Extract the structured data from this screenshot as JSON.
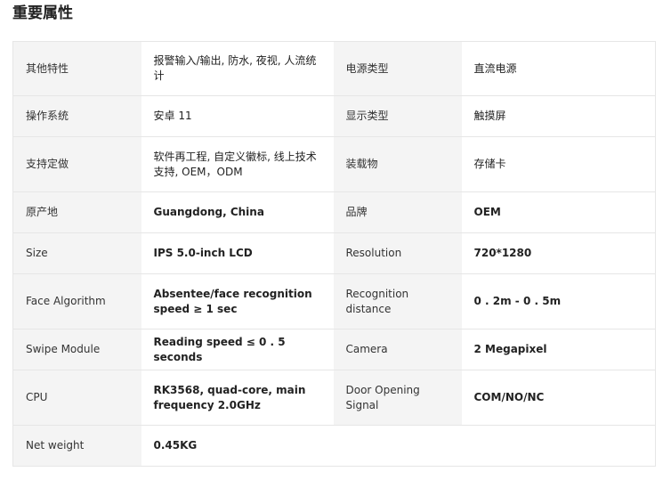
{
  "section_title": "重要属性",
  "rows": [
    [
      {
        "key": "其他特性",
        "value": "报警输入/输出, 防水, 夜视, 人流统计"
      },
      {
        "key": "电源类型",
        "value": "直流电源"
      }
    ],
    [
      {
        "key": "操作系统",
        "value": "安卓 11"
      },
      {
        "key": "显示类型",
        "value": "触摸屏"
      }
    ],
    [
      {
        "key": "支持定做",
        "value": "软件再工程, 自定义徽标, 线上技术支持, OEM，ODM"
      },
      {
        "key": "装载物",
        "value": "存储卡"
      }
    ],
    [
      {
        "key": "原产地",
        "value": "Guangdong, China"
      },
      {
        "key": "品牌",
        "value": "OEM"
      }
    ],
    [
      {
        "key": "Size",
        "value": "IPS 5.0-inch LCD"
      },
      {
        "key": "Resolution",
        "value": "720*1280"
      }
    ],
    [
      {
        "key": "Face Algorithm",
        "value": "Absentee/face recognition speed ≥ 1 sec"
      },
      {
        "key": "Recognition distance",
        "value": "0 . 2m - 0 . 5m"
      }
    ],
    [
      {
        "key": "Swipe Module",
        "value": "Reading speed ≤ 0 . 5 seconds"
      },
      {
        "key": "Camera",
        "value": "2 Megapixel"
      }
    ],
    [
      {
        "key": "CPU",
        "value": "RK3568, quad-core, main frequency 2.0GHz"
      },
      {
        "key": "Door Opening Signal",
        "value": "COM/NO/NC"
      }
    ],
    [
      {
        "key": "Net weight",
        "value": "0.45KG"
      }
    ]
  ]
}
